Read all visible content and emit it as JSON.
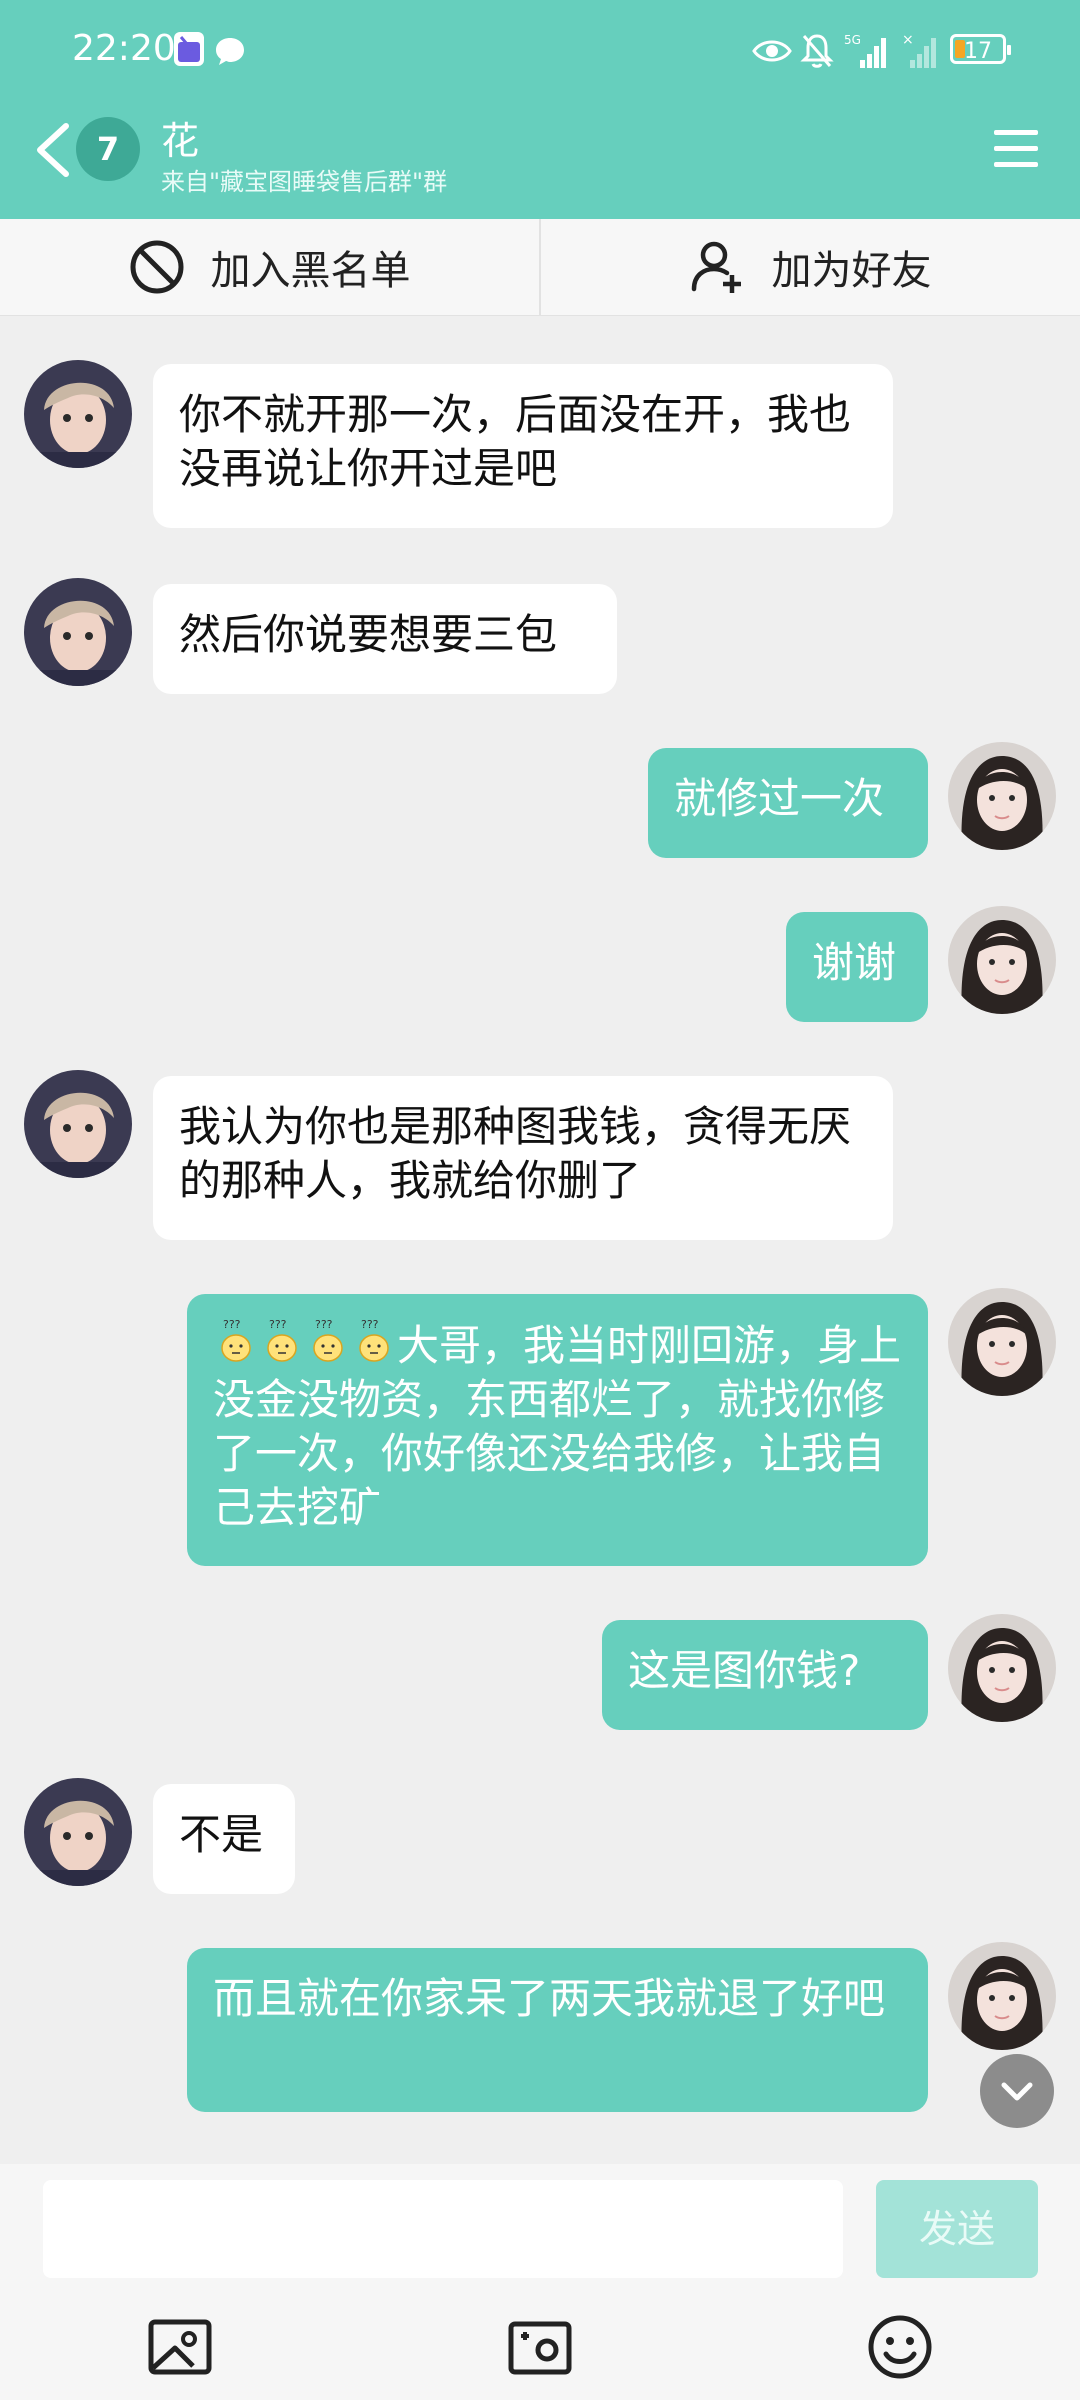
{
  "status_bar": {
    "time": "22:20",
    "battery": "17",
    "icons": [
      "app-notification-icon",
      "chat-bubble-icon",
      "eye-icon",
      "mute-bell-icon",
      "signal-5g-icon",
      "signal-weak-icon",
      "battery-icon"
    ]
  },
  "header": {
    "unread_count": "7",
    "title": "花",
    "subtitle": "来自\"藏宝图睡袋售后群\"群"
  },
  "actions": {
    "blacklist_label": "加入黑名单",
    "add_friend_label": "加为好友"
  },
  "messages": [
    {
      "side": "in",
      "text": "你不就开那一次，后面没在开，我也没再说让你开过是吧"
    },
    {
      "side": "in",
      "text": "然后你说要想要三包"
    },
    {
      "side": "out",
      "text": "就修过一次"
    },
    {
      "side": "out",
      "text": "谢谢"
    },
    {
      "side": "in",
      "text": "我认为你也是那种图我钱，贪得无厌的那种人，我就给你删了"
    },
    {
      "side": "out",
      "emoji_count": 4,
      "emoji": "confused-baby-emoji",
      "text": "大哥，我当时刚回游，身上没金没物资，东西都烂了，就找你修了一次，你好像还没给我修，让我自己去挖矿"
    },
    {
      "side": "out",
      "text": "这是图你钱?"
    },
    {
      "side": "in",
      "text": "不是"
    },
    {
      "side": "out",
      "text": "而且就在你家呆了两天我就退了好吧"
    }
  ],
  "input": {
    "send_label": "发送"
  },
  "colors": {
    "accent": "#66cfbd",
    "accent_dark": "#3ea996",
    "chat_bg": "#efefef"
  }
}
